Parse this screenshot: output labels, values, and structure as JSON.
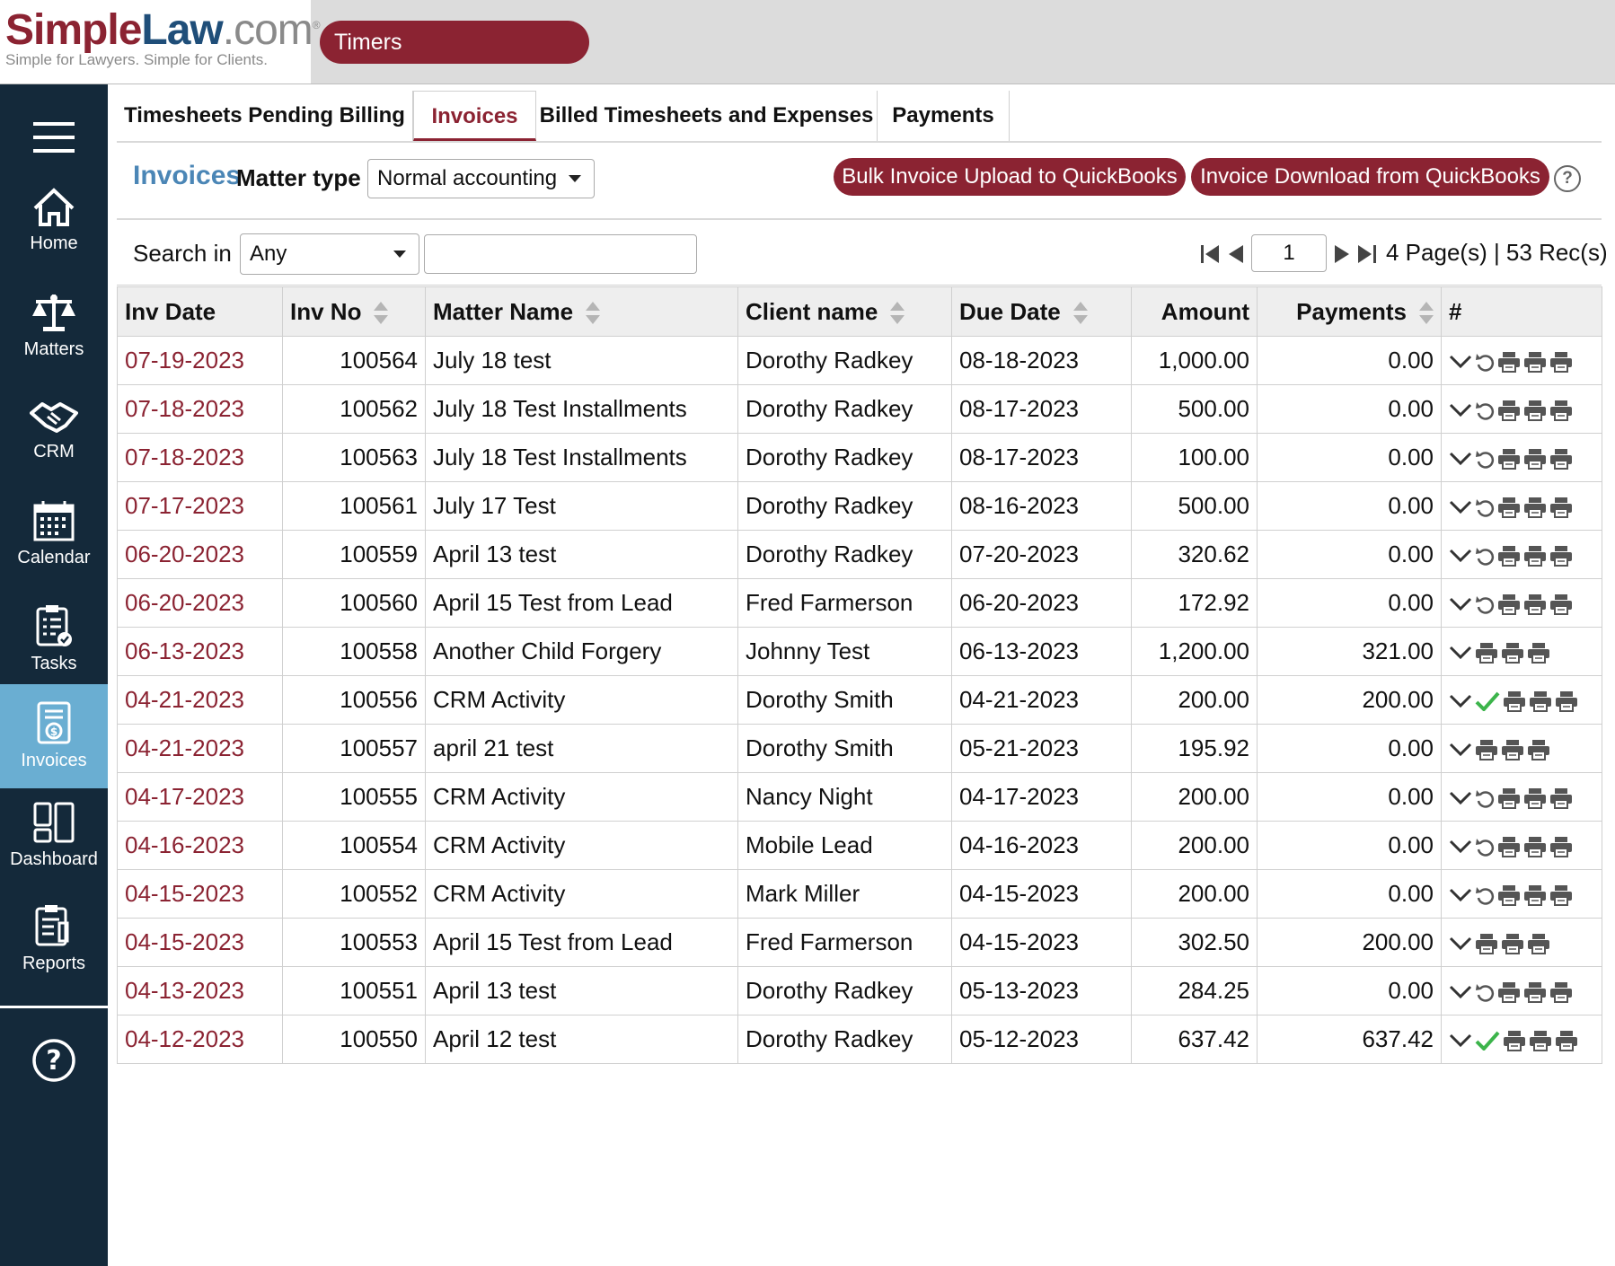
{
  "header": {
    "logo_simple": "Simple",
    "logo_law": "Law",
    "logo_com": ".com",
    "logo_reg": "®",
    "logo_tagline": "Simple for Lawyers. Simple for Clients.",
    "timers_label": "Timers"
  },
  "sidebar": {
    "items": [
      {
        "label": "Home",
        "icon": "home-icon"
      },
      {
        "label": "Matters",
        "icon": "scales-icon"
      },
      {
        "label": "CRM",
        "icon": "handshake-icon"
      },
      {
        "label": "Calendar",
        "icon": "calendar-icon"
      },
      {
        "label": "Tasks",
        "icon": "tasks-icon"
      },
      {
        "label": "Invoices",
        "icon": "invoice-icon"
      },
      {
        "label": "Dashboard",
        "icon": "dashboard-icon"
      },
      {
        "label": "Reports",
        "icon": "reports-icon"
      }
    ],
    "active": "Invoices",
    "help_icon": "?"
  },
  "tabs": {
    "pending": "Timesheets Pending Billing",
    "invoices": "Invoices",
    "billed": "Billed Timesheets and Expenses",
    "payments": "Payments"
  },
  "toolbar": {
    "title": "Invoices",
    "matter_type_label": "Matter type",
    "matter_type_value": "Normal accounting",
    "bulk_upload": "Bulk Invoice Upload to QuickBooks",
    "download": "Invoice Download from QuickBooks",
    "help": "?"
  },
  "search": {
    "label": "Search in",
    "scope": "Any",
    "query": "",
    "page": "1",
    "page_info": "4 Page(s) | 53 Rec(s)"
  },
  "colors": {
    "brand_red": "#8b2332",
    "brand_blue": "#1f4e79",
    "sidebar_bg": "#14293a",
    "sidebar_active": "#6aaed2",
    "check_green": "#3cb44b"
  },
  "table": {
    "columns": [
      "Inv Date",
      "Inv No",
      "Matter Name",
      "Client name",
      "Due Date",
      "Amount",
      "Payments",
      "#"
    ],
    "rows": [
      {
        "inv_date": "07-19-2023",
        "inv_no": "100564",
        "matter": "July 18 test",
        "client": "Dorothy Radkey",
        "due": "08-18-2023",
        "amount": "1,000.00",
        "payments": "0.00",
        "status": "undo",
        "printers": 3
      },
      {
        "inv_date": "07-18-2023",
        "inv_no": "100562",
        "matter": "July 18 Test Installments",
        "client": "Dorothy Radkey",
        "due": "08-17-2023",
        "amount": "500.00",
        "payments": "0.00",
        "status": "undo",
        "printers": 3
      },
      {
        "inv_date": "07-18-2023",
        "inv_no": "100563",
        "matter": "July 18 Test Installments",
        "client": "Dorothy Radkey",
        "due": "08-17-2023",
        "amount": "100.00",
        "payments": "0.00",
        "status": "undo",
        "printers": 3
      },
      {
        "inv_date": "07-17-2023",
        "inv_no": "100561",
        "matter": "July 17 Test",
        "client": "Dorothy Radkey",
        "due": "08-16-2023",
        "amount": "500.00",
        "payments": "0.00",
        "status": "undo",
        "printers": 3
      },
      {
        "inv_date": "06-20-2023",
        "inv_no": "100559",
        "matter": "April 13 test",
        "client": "Dorothy Radkey",
        "due": "07-20-2023",
        "amount": "320.62",
        "payments": "0.00",
        "status": "undo",
        "printers": 3
      },
      {
        "inv_date": "06-20-2023",
        "inv_no": "100560",
        "matter": "April 15 Test from Lead",
        "client": "Fred Farmerson",
        "due": "06-20-2023",
        "amount": "172.92",
        "payments": "0.00",
        "status": "undo",
        "printers": 3
      },
      {
        "inv_date": "06-13-2023",
        "inv_no": "100558",
        "matter": "Another Child Forgery",
        "client": "Johnny Test",
        "due": "06-13-2023",
        "amount": "1,200.00",
        "payments": "321.00",
        "status": "none",
        "printers": 3
      },
      {
        "inv_date": "04-21-2023",
        "inv_no": "100556",
        "matter": "CRM Activity",
        "client": "Dorothy Smith",
        "due": "04-21-2023",
        "amount": "200.00",
        "payments": "200.00",
        "status": "check",
        "printers": 3
      },
      {
        "inv_date": "04-21-2023",
        "inv_no": "100557",
        "matter": "april 21 test",
        "client": "Dorothy Smith",
        "due": "05-21-2023",
        "amount": "195.92",
        "payments": "0.00",
        "status": "none",
        "printers": 3
      },
      {
        "inv_date": "04-17-2023",
        "inv_no": "100555",
        "matter": "CRM Activity",
        "client": "Nancy Night",
        "due": "04-17-2023",
        "amount": "200.00",
        "payments": "0.00",
        "status": "undo",
        "printers": 3
      },
      {
        "inv_date": "04-16-2023",
        "inv_no": "100554",
        "matter": "CRM Activity",
        "client": "Mobile Lead",
        "due": "04-16-2023",
        "amount": "200.00",
        "payments": "0.00",
        "status": "undo",
        "printers": 3
      },
      {
        "inv_date": "04-15-2023",
        "inv_no": "100552",
        "matter": "CRM Activity",
        "client": "Mark Miller",
        "due": "04-15-2023",
        "amount": "200.00",
        "payments": "0.00",
        "status": "undo",
        "printers": 3
      },
      {
        "inv_date": "04-15-2023",
        "inv_no": "100553",
        "matter": "April 15 Test from Lead",
        "client": "Fred Farmerson",
        "due": "04-15-2023",
        "amount": "302.50",
        "payments": "200.00",
        "status": "none",
        "printers": 3
      },
      {
        "inv_date": "04-13-2023",
        "inv_no": "100551",
        "matter": "April 13 test",
        "client": "Dorothy Radkey",
        "due": "05-13-2023",
        "amount": "284.25",
        "payments": "0.00",
        "status": "undo",
        "printers": 3
      },
      {
        "inv_date": "04-12-2023",
        "inv_no": "100550",
        "matter": "April 12 test",
        "client": "Dorothy Radkey",
        "due": "05-12-2023",
        "amount": "637.42",
        "payments": "637.42",
        "status": "check",
        "printers": 3
      }
    ]
  }
}
